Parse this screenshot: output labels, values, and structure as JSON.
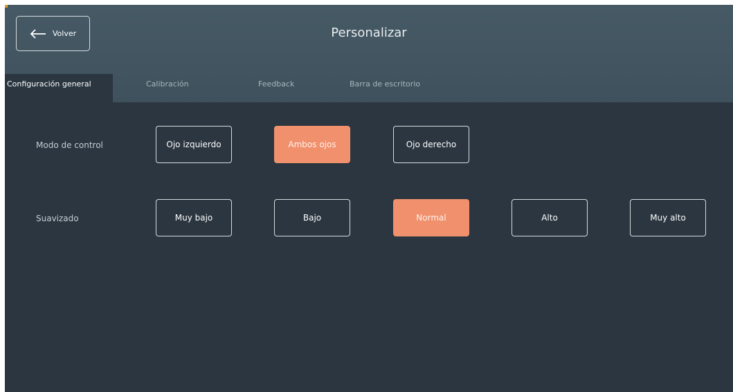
{
  "header": {
    "back_label": "Volver",
    "title": "Personalizar"
  },
  "tabs": [
    {
      "label": "Configuración general",
      "active": true
    },
    {
      "label": "Calibración",
      "active": false
    },
    {
      "label": "Feedback",
      "active": false
    },
    {
      "label": "Barra de escritorio",
      "active": false
    }
  ],
  "control_mode": {
    "label": "Modo de control",
    "options": [
      "Ojo izquierdo",
      "Ambos ojos",
      "Ojo derecho"
    ],
    "selected": "Ambos ojos"
  },
  "smoothing": {
    "label": "Suavizado",
    "options": [
      "Muy bajo",
      "Bajo",
      "Normal",
      "Alto",
      "Muy alto"
    ],
    "selected": "Normal"
  },
  "colors": {
    "background": "#2b3640",
    "header": "#43555f",
    "selected": "#f0906c"
  },
  "icons": {
    "back": "arrow-left-icon"
  }
}
